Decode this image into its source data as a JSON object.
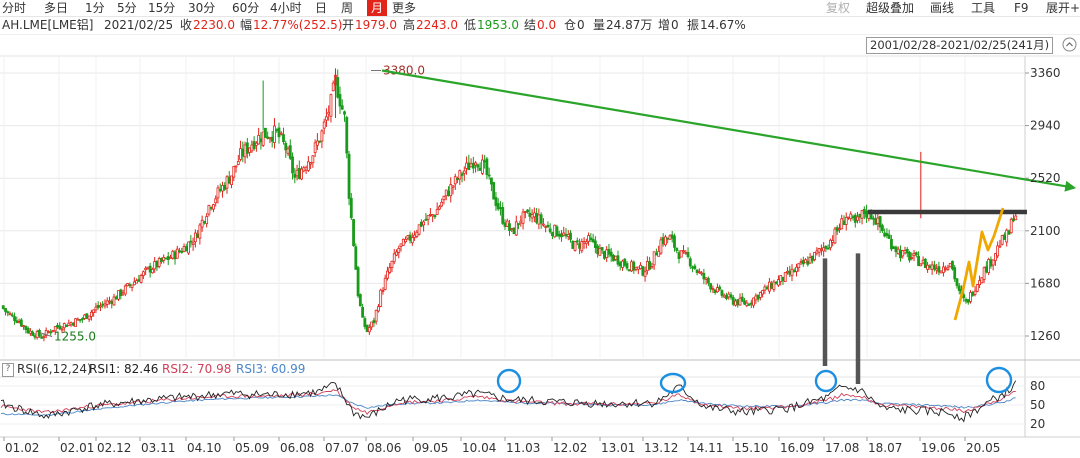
{
  "toolbar": {
    "left_items": [
      "分时",
      "多日",
      "1分",
      "5分",
      "15分",
      "30分",
      "60分",
      "4小时",
      "日",
      "周",
      "月",
      "更多"
    ],
    "active_item": "月",
    "right_items": [
      "复权",
      "超级叠加",
      "画线",
      "工具",
      "F9",
      "展开+"
    ],
    "disabled_items": [
      "复权"
    ]
  },
  "quote": {
    "symbol": "AH.LME[LME铝]",
    "date": "2021/02/25",
    "close_label": "收",
    "close": "2230.0",
    "change_label": "幅",
    "change": "12.77%(252.5)",
    "open_label": "开",
    "open": "1979.0",
    "high_label": "高",
    "high": "2243.0",
    "low_label": "低",
    "low": "1953.0",
    "settle_label": "结",
    "settle": "0.0",
    "position_label": "仓",
    "position": "0",
    "volume_label": "量",
    "volume": "24.87万",
    "increase_label": "增",
    "increase": "0",
    "amplitude_label": "振",
    "amplitude": "14.67%"
  },
  "range": {
    "label": "2001/02/28-2021/02/25(241月)"
  },
  "rsi_header": {
    "name": "RSI(6,12,24)",
    "rsi1": "RSI1: 82.46",
    "rsi2": "RSI2: 70.98",
    "rsi3": "RSI3: 60.99"
  },
  "colors": {
    "up": "#e2231a",
    "down": "#1a9a1a",
    "trendline": "#2aa52a",
    "resistance": "#3a3a3a",
    "support_bars": "#555555",
    "highlight_line": "#f0a800",
    "circle": "#1e8fe0",
    "rsi1": "#222222",
    "rsi2": "#d0405a",
    "rsi3": "#4a86c8",
    "grid": "#e8e8e8"
  },
  "chart_data": {
    "type": "candlestick",
    "price_axis": {
      "ticks": [
        1260,
        1680,
        2100,
        2520,
        2940,
        3360
      ],
      "ylim": [
        1100,
        3500
      ]
    },
    "x_axis": {
      "labels": [
        "01.02",
        "02.01",
        "02.12",
        "03.11",
        "04.10",
        "05.09",
        "06.08",
        "07.07",
        "08.06",
        "09.05",
        "10.04",
        "11.03",
        "12.02",
        "13.01",
        "13.12",
        "14.11",
        "15.10",
        "16.09",
        "17.08",
        "18.07",
        "19.06",
        "20.05"
      ]
    },
    "annotations": {
      "max_label": "3380.0",
      "min_label": "1255.0",
      "max_value": 3380,
      "min_value": 1255
    },
    "keypoints": [
      [
        0,
        1500
      ],
      [
        3,
        1440
      ],
      [
        8,
        1380
      ],
      [
        12,
        1300
      ],
      [
        18,
        1255
      ],
      [
        24,
        1330
      ],
      [
        30,
        1360
      ],
      [
        36,
        1400
      ],
      [
        42,
        1480
      ],
      [
        50,
        1560
      ],
      [
        58,
        1680
      ],
      [
        66,
        1800
      ],
      [
        74,
        1880
      ],
      [
        80,
        1950
      ],
      [
        86,
        2050
      ],
      [
        92,
        2300
      ],
      [
        98,
        2450
      ],
      [
        102,
        2550
      ],
      [
        106,
        2700
      ],
      [
        112,
        2820
      ],
      [
        116,
        2870
      ],
      [
        122,
        2880
      ],
      [
        126,
        2760
      ],
      [
        130,
        2520
      ],
      [
        134,
        2620
      ],
      [
        138,
        2720
      ],
      [
        142,
        2880
      ],
      [
        146,
        3120
      ],
      [
        148,
        3300
      ],
      [
        150,
        3150
      ],
      [
        152,
        3000
      ],
      [
        154,
        2400
      ],
      [
        156,
        2000
      ],
      [
        158,
        1600
      ],
      [
        160,
        1380
      ],
      [
        162,
        1300
      ],
      [
        165,
        1380
      ],
      [
        168,
        1600
      ],
      [
        172,
        1800
      ],
      [
        176,
        1960
      ],
      [
        180,
        2020
      ],
      [
        186,
        2160
      ],
      [
        192,
        2240
      ],
      [
        198,
        2420
      ],
      [
        204,
        2560
      ],
      [
        210,
        2680
      ],
      [
        214,
        2600
      ],
      [
        218,
        2380
      ],
      [
        222,
        2200
      ],
      [
        226,
        2080
      ],
      [
        230,
        2200
      ],
      [
        236,
        2220
      ],
      [
        242,
        2120
      ],
      [
        248,
        2080
      ],
      [
        254,
        1980
      ],
      [
        260,
        2020
      ],
      [
        266,
        1920
      ],
      [
        272,
        1880
      ],
      [
        278,
        1820
      ],
      [
        284,
        1780
      ],
      [
        288,
        1850
      ],
      [
        292,
        2020
      ],
      [
        296,
        2040
      ],
      [
        300,
        1920
      ],
      [
        304,
        1880
      ],
      [
        308,
        1780
      ],
      [
        312,
        1700
      ],
      [
        318,
        1600
      ],
      [
        324,
        1540
      ],
      [
        330,
        1520
      ],
      [
        336,
        1600
      ],
      [
        342,
        1680
      ],
      [
        348,
        1740
      ],
      [
        354,
        1820
      ],
      [
        360,
        1900
      ],
      [
        366,
        2000
      ],
      [
        370,
        2100
      ],
      [
        374,
        2220
      ],
      [
        378,
        2150
      ],
      [
        382,
        2250
      ],
      [
        386,
        2220
      ],
      [
        390,
        2100
      ],
      [
        394,
        2000
      ],
      [
        398,
        1920
      ],
      [
        404,
        1880
      ],
      [
        410,
        1820
      ],
      [
        416,
        1800
      ],
      [
        420,
        1860
      ],
      [
        424,
        1600
      ],
      [
        427,
        1520
      ],
      [
        430,
        1620
      ],
      [
        434,
        1760
      ],
      [
        438,
        1860
      ],
      [
        442,
        2000
      ],
      [
        446,
        2080
      ],
      [
        448,
        2230
      ]
    ],
    "trendline": {
      "from": {
        "x_index": 166,
        "value": 3380
      },
      "to": {
        "x_index": 475,
        "value": 2460
      }
    },
    "resistance_level": 2250,
    "rsi": {
      "yticks": [
        20,
        50,
        80
      ],
      "ylim": [
        0,
        100
      ],
      "rsi1_keys": [
        [
          0,
          52
        ],
        [
          20,
          32
        ],
        [
          40,
          48
        ],
        [
          60,
          56
        ],
        [
          80,
          62
        ],
        [
          100,
          68
        ],
        [
          120,
          66
        ],
        [
          140,
          70
        ],
        [
          148,
          82
        ],
        [
          156,
          38
        ],
        [
          162,
          30
        ],
        [
          176,
          58
        ],
        [
          200,
          62
        ],
        [
          210,
          68
        ],
        [
          226,
          58
        ],
        [
          250,
          54
        ],
        [
          270,
          52
        ],
        [
          290,
          54
        ],
        [
          300,
          78
        ],
        [
          312,
          46
        ],
        [
          330,
          38
        ],
        [
          350,
          46
        ],
        [
          366,
          62
        ],
        [
          372,
          78
        ],
        [
          380,
          74
        ],
        [
          390,
          44
        ],
        [
          410,
          40
        ],
        [
          420,
          38
        ],
        [
          426,
          30
        ],
        [
          436,
          52
        ],
        [
          446,
          72
        ],
        [
          448,
          82
        ]
      ],
      "rsi2_keys": [
        [
          0,
          48
        ],
        [
          20,
          38
        ],
        [
          40,
          48
        ],
        [
          60,
          54
        ],
        [
          80,
          60
        ],
        [
          100,
          64
        ],
        [
          120,
          64
        ],
        [
          140,
          68
        ],
        [
          148,
          74
        ],
        [
          156,
          46
        ],
        [
          162,
          38
        ],
        [
          176,
          54
        ],
        [
          200,
          58
        ],
        [
          210,
          64
        ],
        [
          226,
          56
        ],
        [
          250,
          52
        ],
        [
          270,
          51
        ],
        [
          290,
          53
        ],
        [
          300,
          66
        ],
        [
          312,
          50
        ],
        [
          330,
          44
        ],
        [
          350,
          48
        ],
        [
          366,
          58
        ],
        [
          372,
          66
        ],
        [
          380,
          64
        ],
        [
          390,
          50
        ],
        [
          410,
          46
        ],
        [
          420,
          44
        ],
        [
          426,
          40
        ],
        [
          436,
          52
        ],
        [
          446,
          64
        ],
        [
          448,
          71
        ]
      ],
      "rsi3_keys": [
        [
          0,
          36
        ],
        [
          20,
          34
        ],
        [
          40,
          42
        ],
        [
          60,
          50
        ],
        [
          80,
          56
        ],
        [
          100,
          60
        ],
        [
          120,
          62
        ],
        [
          140,
          64
        ],
        [
          148,
          66
        ],
        [
          156,
          52
        ],
        [
          162,
          46
        ],
        [
          176,
          52
        ],
        [
          200,
          54
        ],
        [
          210,
          58
        ],
        [
          226,
          54
        ],
        [
          250,
          52
        ],
        [
          270,
          50
        ],
        [
          290,
          51
        ],
        [
          300,
          58
        ],
        [
          312,
          52
        ],
        [
          330,
          48
        ],
        [
          350,
          48
        ],
        [
          366,
          54
        ],
        [
          372,
          58
        ],
        [
          380,
          58
        ],
        [
          390,
          52
        ],
        [
          410,
          50
        ],
        [
          420,
          48
        ],
        [
          426,
          46
        ],
        [
          436,
          50
        ],
        [
          446,
          56
        ],
        [
          448,
          61
        ]
      ]
    }
  }
}
